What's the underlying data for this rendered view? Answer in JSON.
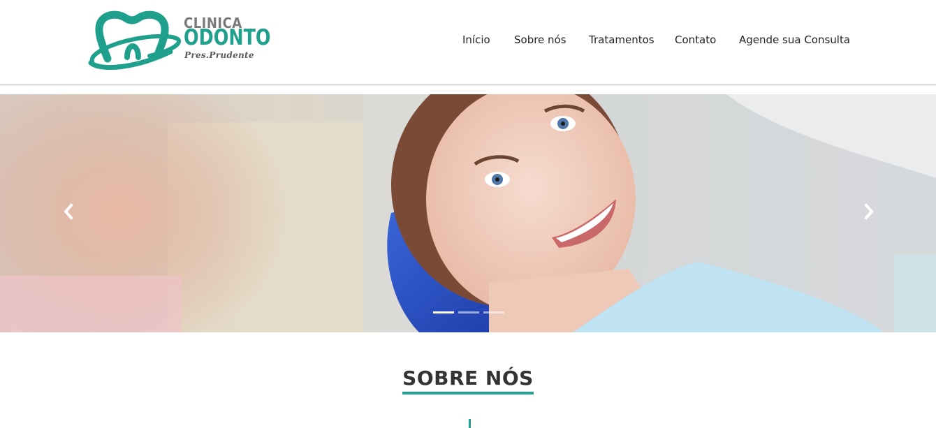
{
  "brand": {
    "line1": "CLINICA",
    "line2": "ODONTO",
    "line3": "Pres.Prudente",
    "icon": "tooth-logo-icon",
    "color_primary": "#1ea08c",
    "color_gray": "#7a7a7a"
  },
  "nav": {
    "items": [
      {
        "label": "Início"
      },
      {
        "label": "Sobre nós"
      },
      {
        "label": "Tratamentos"
      },
      {
        "label": "Contato"
      },
      {
        "label": "Agende sua Consulta"
      }
    ]
  },
  "carousel": {
    "prev_icon": "chevron-left-icon",
    "next_icon": "chevron-right-icon",
    "slide_count": 3,
    "active_index": 0
  },
  "about": {
    "title": "SOBRE NÓS",
    "accent_color": "#20a392"
  }
}
